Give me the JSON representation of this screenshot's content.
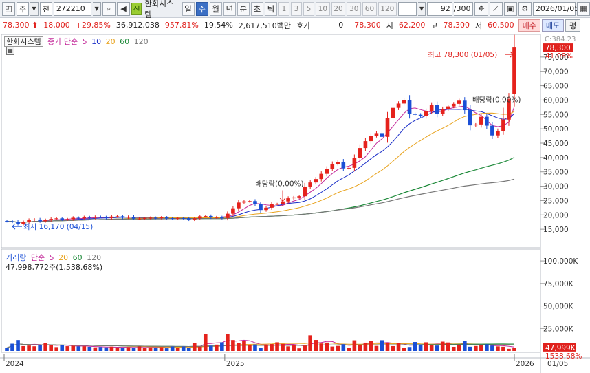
{
  "toolbar": {
    "market_label": "주",
    "prev_label": "전",
    "code": "272210",
    "kind_badge": "신",
    "stock_name": "한화시스템",
    "periods": [
      "일",
      "주",
      "월",
      "년",
      "분",
      "초",
      "틱"
    ],
    "active_period": "주",
    "intervals": [
      "1",
      "3",
      "5",
      "10",
      "20",
      "30",
      "60",
      "120"
    ],
    "count": "92",
    "count_max": "/300",
    "date": "2026/01/05"
  },
  "quote": {
    "price": "78,300",
    "change": "18,000",
    "change_pct": "+29.85%",
    "volume": "36,912,038",
    "volume_ratio": "957.81%",
    "turnover": "19.54%",
    "amount": "2,617,510백만",
    "hoga_label": "호가",
    "hoga_value": "0",
    "hoga_price": "78,300",
    "open_label": "시",
    "open": "62,200",
    "high_label": "고",
    "high": "78,300",
    "low_label": "저",
    "low": "60,500",
    "buy_label": "매수",
    "sell_label": "매도",
    "eval_label": "평"
  },
  "price_panel": {
    "name": "한화시스템",
    "legend_label": "종가 단순",
    "ma": [
      "5",
      "10",
      "20",
      "60",
      "120"
    ],
    "ma_colors": [
      "#c42a9a",
      "#1b2fc8",
      "#e8a21b",
      "#1e8a3a",
      "#777777"
    ],
    "high_note": "최고 78,300 (01/05)",
    "low_note": "최저 16,170 (04/15)",
    "dividend_note": "배당락(0.00%)",
    "last_price_tag": "78,300",
    "last_pct_tag": "41.08%",
    "top_tag": "C:384.23",
    "axis": [
      "75,000",
      "70,000",
      "65,000",
      "60,000",
      "55,000",
      "50,000",
      "45,000",
      "40,000",
      "35,000",
      "30,000",
      "25,000",
      "20,000",
      "15,000"
    ]
  },
  "volume_panel": {
    "legend_label": "거래량",
    "legend_ma_label": "단순",
    "ma": [
      "5",
      "20",
      "60",
      "120"
    ],
    "ma_colors": [
      "#c42a9a",
      "#e8a21b",
      "#1e8a3a",
      "#777777"
    ],
    "current": "47,998,772주(1,538.68%)",
    "last_volume_tag": "47,999K",
    "last_pct_tag": "1538.68%",
    "axis": [
      "100,000K",
      "75,000K",
      "50,000K",
      "25,000K"
    ]
  },
  "time_axis": [
    "2024",
    "2025",
    "2026"
  ],
  "time_axis_right": "01/05",
  "colors": {
    "up": "#e5221c",
    "down": "#1a4fd6",
    "accent": "#3b6fc4"
  },
  "chart_data": {
    "type": "candlestick",
    "period": "weekly",
    "series": [
      {
        "name": "가격",
        "open": [
          17.9,
          17.8,
          17.6,
          16.9,
          17.5,
          18.2,
          18.4,
          17.8,
          18.2,
          18.6,
          18.8,
          18.4,
          18.5,
          19.0,
          18.8,
          19.2,
          19.0,
          19.3,
          19.2,
          18.9,
          19.4,
          19.5,
          19.0,
          19.3,
          18.7,
          18.7,
          18.9,
          19.0,
          18.9,
          19.1,
          18.8,
          18.7,
          18.9,
          18.8,
          18.4,
          18.8,
          19.5,
          19.6,
          19.1,
          19.2,
          18.9,
          20.4,
          22.3,
          24.3,
          24.7,
          24.8,
          23.7,
          21.7,
          22.5,
          23.8,
          23.8,
          24.7,
          25.8,
          26.1,
          26.5,
          29.9,
          31.3,
          32.5,
          34.3,
          36.1,
          37.8,
          38.5,
          36.2,
          36.4,
          39.8,
          43.3,
          45.7,
          47.6,
          48.5,
          47.2,
          53.8,
          57.3,
          58.8,
          60.1,
          55.2,
          54.9,
          54.4,
          56.2,
          58.3,
          55.2,
          56.9,
          57.8,
          58.7,
          59.8,
          56.5,
          51.2,
          51.5,
          54.2,
          51.1,
          47.7,
          49.3,
          53.2,
          62.2
        ],
        "close": [
          17.8,
          17.6,
          16.9,
          17.5,
          18.2,
          18.4,
          17.8,
          18.2,
          18.6,
          18.8,
          18.4,
          18.5,
          19.0,
          18.8,
          19.2,
          19.0,
          19.3,
          19.2,
          18.9,
          19.4,
          19.5,
          19.0,
          19.3,
          18.7,
          18.7,
          18.9,
          19.0,
          18.9,
          19.1,
          18.8,
          18.7,
          18.9,
          18.8,
          18.4,
          18.8,
          19.5,
          19.6,
          19.1,
          19.2,
          18.9,
          20.4,
          22.3,
          24.3,
          24.7,
          24.8,
          23.7,
          21.7,
          22.5,
          23.8,
          23.8,
          24.7,
          25.8,
          26.1,
          26.5,
          29.9,
          31.3,
          32.5,
          34.3,
          36.1,
          37.8,
          38.5,
          36.2,
          36.4,
          39.8,
          43.3,
          45.7,
          47.6,
          48.5,
          47.2,
          53.8,
          57.3,
          58.8,
          60.1,
          55.2,
          54.9,
          54.4,
          56.2,
          58.3,
          55.2,
          56.9,
          57.8,
          58.7,
          59.8,
          56.5,
          51.2,
          51.5,
          54.2,
          51.1,
          47.7,
          49.3,
          53.2,
          60.3,
          78.3
        ]
      },
      {
        "name": "거래량",
        "values": [
          3.5,
          8.0,
          12.1,
          5.4,
          6.0,
          5.2,
          6.3,
          9.0,
          6.3,
          4.3,
          6.5,
          5.3,
          5.7,
          5.1,
          5.2,
          4.6,
          4.0,
          4.4,
          4.0,
          4.8,
          3.9,
          3.5,
          4.3,
          3.1,
          5.0,
          3.6,
          4.1,
          3.5,
          4.3,
          3.0,
          4.9,
          3.2,
          4.9,
          3.1,
          8.7,
          4.8,
          18.5,
          5.8,
          7.0,
          9.6,
          18.5,
          12.1,
          8.6,
          10.7,
          6.7,
          7.2,
          3.6,
          6.3,
          7.6,
          9.6,
          7.8,
          5.1,
          6.1,
          2.9,
          5.9,
          17.3,
          12.2,
          8.2,
          9.3,
          4.9,
          5.6,
          7.5,
          3.7,
          11.8,
          6.7,
          9.2,
          11.0,
          5.6,
          11.9,
          9.2,
          5.4,
          8.5,
          3.8,
          4.4,
          9.9,
          7.2,
          9.6,
          6.4,
          6.0,
          10.3,
          9.4,
          4.6,
          7.0,
          11.0,
          4.7,
          5.5,
          6.1,
          7.4,
          5.9,
          5.1,
          4.7,
          2.4,
          3.7
        ]
      }
    ]
  }
}
